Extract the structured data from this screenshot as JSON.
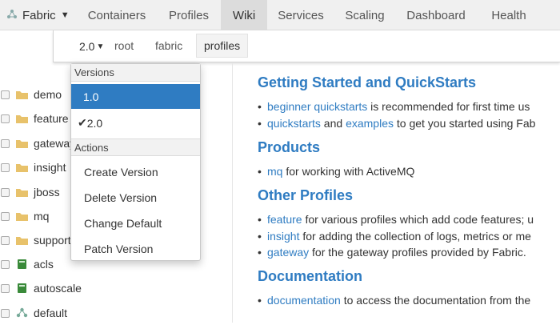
{
  "topnav": {
    "brand": "Fabric",
    "tabs": [
      {
        "label": "Containers"
      },
      {
        "label": "Profiles"
      },
      {
        "label": "Wiki"
      },
      {
        "label": "Services"
      },
      {
        "label": "Scaling"
      },
      {
        "label": "Dashboard"
      },
      {
        "label": "Health"
      }
    ],
    "active_tab": "Wiki"
  },
  "subnav": {
    "version": "2.0",
    "crumbs": [
      "root",
      "fabric",
      "profiles"
    ]
  },
  "tree": {
    "items": [
      {
        "label": "demo",
        "icon": "folder-icon"
      },
      {
        "label": "feature",
        "icon": "folder-icon"
      },
      {
        "label": "gateway",
        "icon": "folder-icon"
      },
      {
        "label": "insight",
        "icon": "folder-icon"
      },
      {
        "label": "jboss",
        "icon": "folder-icon"
      },
      {
        "label": "mq",
        "icon": "folder-icon"
      },
      {
        "label": "support",
        "icon": "folder-icon"
      },
      {
        "label": "acls",
        "icon": "book-icon"
      },
      {
        "label": "autoscale",
        "icon": "book-icon"
      },
      {
        "label": "default",
        "icon": "cluster-icon"
      }
    ]
  },
  "dropdown": {
    "versions_header": "Versions",
    "versions": [
      "1.0",
      "2.0"
    ],
    "actions_header": "Actions",
    "actions": [
      "Create Version",
      "Delete Version",
      "Change Default",
      "Patch Version"
    ]
  },
  "content": {
    "s1": {
      "title": "Getting Started and QuickStarts",
      "l1": {
        "link": "beginner quickstarts",
        "text": " is recommended for first time us"
      },
      "l2": {
        "link1": "quickstarts",
        "mid": " and ",
        "link2": "examples",
        "text": " to get you started using Fab"
      }
    },
    "s2": {
      "title": "Products",
      "l1": {
        "link": "mq",
        "text": " for working with ActiveMQ"
      }
    },
    "s3": {
      "title": "Other Profiles",
      "l1": {
        "link": "feature",
        "text": " for various profiles which add code features; u"
      },
      "l2": {
        "link": "insight",
        "text": " for adding the collection of logs, metrics or me"
      },
      "l3": {
        "link": "gateway",
        "text": " for the gateway profiles provided by Fabric."
      }
    },
    "s4": {
      "title": "Documentation",
      "l1": {
        "link": "documentation",
        "text": " to access the documentation from the"
      }
    }
  },
  "colors": {
    "accent": "#2f7cc2",
    "folder": "#e8c26b",
    "book": "#3a8a3a"
  }
}
